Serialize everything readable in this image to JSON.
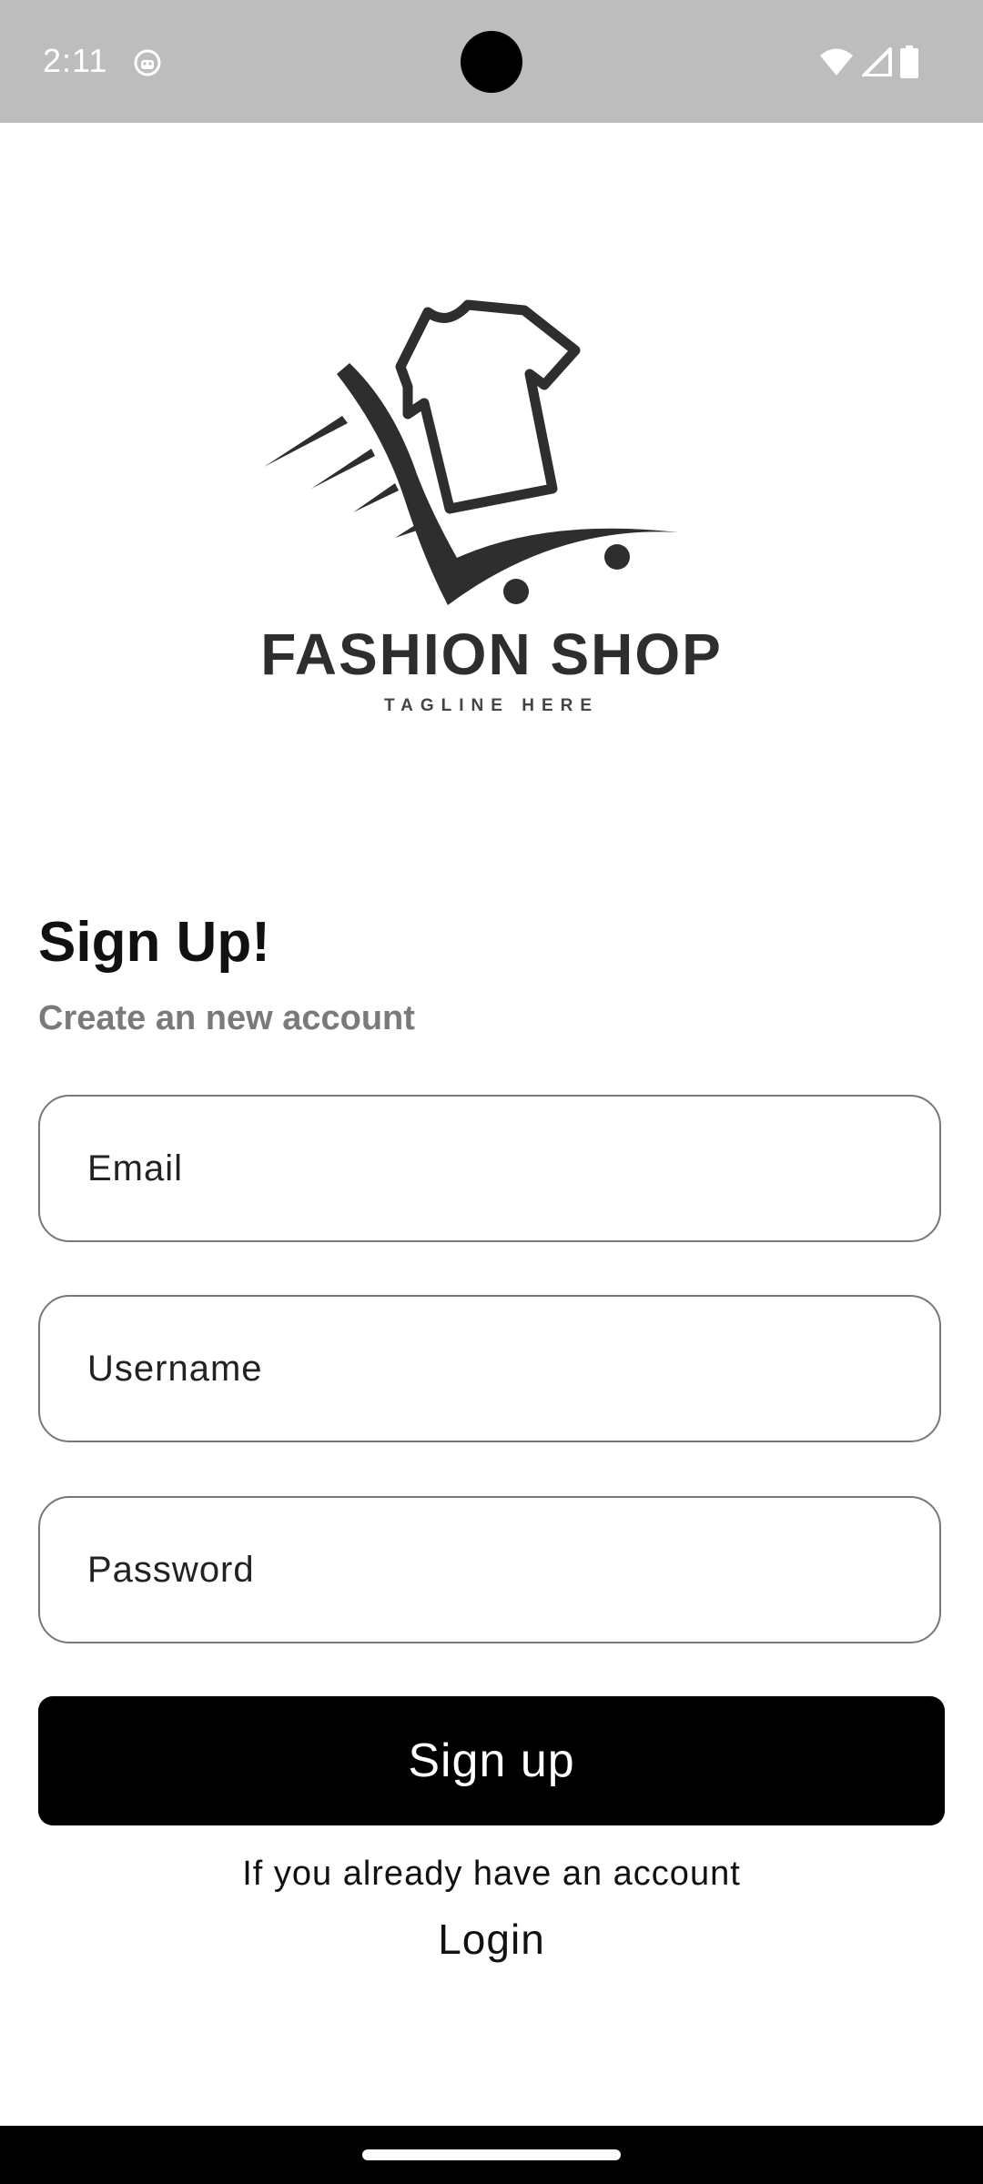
{
  "status_bar": {
    "time": "2:11",
    "icons": [
      "app-notification-icon",
      "wifi-icon",
      "cellular-signal-icon",
      "battery-icon"
    ]
  },
  "logo": {
    "brand_name": "FASHION SHOP",
    "tagline": "TAGLINE HERE",
    "icon": "tshirt-cart-icon"
  },
  "form": {
    "title": "Sign Up!",
    "subtitle": "Create an new account",
    "email_placeholder": "Email",
    "username_placeholder": "Username",
    "password_placeholder": "Password",
    "submit_label": "Sign up"
  },
  "footer": {
    "login_hint": "If you already have an account",
    "login_label": "Login"
  },
  "colors": {
    "status_bar_bg": "#bdbdbd",
    "button_bg": "#000000",
    "button_text": "#ffffff",
    "field_border": "#777777",
    "subtitle_text": "#7a7a7a"
  }
}
